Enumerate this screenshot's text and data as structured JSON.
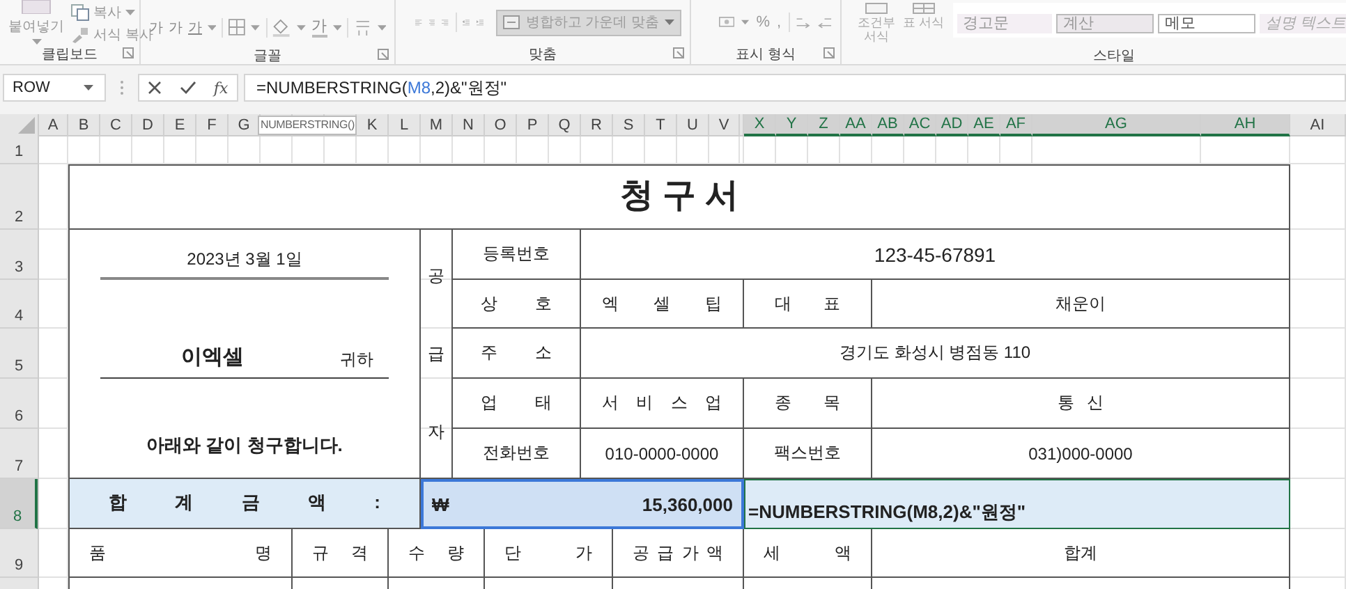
{
  "ribbon": {
    "clipboard": {
      "label": "클립보드",
      "paste": "붙여넣기",
      "copy": "복사",
      "format_painter": "서식 복사"
    },
    "font": {
      "label": "글꼴",
      "buttons": [
        "가",
        "가",
        "가"
      ],
      "font_color": "가"
    },
    "alignment": {
      "label": "맞춤",
      "merge": "병합하고 가운데 맞춤"
    },
    "number": {
      "label": "표시 형식",
      "percent": "%",
      "comma": ","
    },
    "styles": {
      "label": "스타일",
      "conditional": "조건부 서식",
      "table": "표 서식",
      "cells": [
        {
          "label": "경고문",
          "kind": "plain"
        },
        {
          "label": "계산",
          "kind": "calc"
        },
        {
          "label": "메모",
          "kind": "memo"
        },
        {
          "label": "설명 텍스트",
          "kind": "explain"
        }
      ]
    }
  },
  "formula_bar": {
    "name_box": "ROW",
    "function_button": "fx",
    "formula": [
      {
        "text": "=NUMBERSTRING(",
        "kind": "plain"
      },
      {
        "text": "M8",
        "kind": "reference"
      },
      {
        "text": ",2)&\"원정\"",
        "kind": "plain"
      }
    ],
    "tooltip": "NUMBERSTRING()"
  },
  "columns": [
    {
      "label": "A",
      "selected": false
    },
    {
      "label": "B",
      "selected": false
    },
    {
      "label": "C",
      "selected": false
    },
    {
      "label": "D",
      "selected": false
    },
    {
      "label": "E",
      "selected": false
    },
    {
      "label": "F",
      "selected": false
    },
    {
      "label": "G",
      "selected": false
    },
    {
      "label": "K",
      "selected": false
    },
    {
      "label": "L",
      "selected": false
    },
    {
      "label": "M",
      "selected": false
    },
    {
      "label": "N",
      "selected": false
    },
    {
      "label": "O",
      "selected": false
    },
    {
      "label": "P",
      "selected": false
    },
    {
      "label": "Q",
      "selected": false
    },
    {
      "label": "R",
      "selected": false
    },
    {
      "label": "S",
      "selected": false
    },
    {
      "label": "T",
      "selected": false
    },
    {
      "label": "U",
      "selected": false
    },
    {
      "label": "V",
      "selected": false
    },
    {
      "label": "X",
      "selected": true
    },
    {
      "label": "Y",
      "selected": true
    },
    {
      "label": "Z",
      "selected": true
    },
    {
      "label": "AA",
      "selected": true
    },
    {
      "label": "AB",
      "selected": true
    },
    {
      "label": "AC",
      "selected": true
    },
    {
      "label": "AD",
      "selected": true
    },
    {
      "label": "AE",
      "selected": true
    },
    {
      "label": "AF",
      "selected": true
    },
    {
      "label": "AG",
      "selected": true
    },
    {
      "label": "AH",
      "selected": true
    },
    {
      "label": "AI",
      "selected": false
    }
  ],
  "rows": [
    {
      "label": "1",
      "selected": false
    },
    {
      "label": "2",
      "selected": false
    },
    {
      "label": "3",
      "selected": false
    },
    {
      "label": "4",
      "selected": false
    },
    {
      "label": "5",
      "selected": false
    },
    {
      "label": "6",
      "selected": false
    },
    {
      "label": "7",
      "selected": false
    },
    {
      "label": "8",
      "selected": true
    },
    {
      "label": "9",
      "selected": false
    }
  ],
  "invoice": {
    "title": "청 구 서",
    "date": "2023년 3월 1일",
    "recipient": "이엑셀",
    "honorific": "귀하",
    "message": "아래와 같이 청구합니다.",
    "supplier_label": "공급자",
    "registration": {
      "label": "등록번호",
      "value": "123-45-67891"
    },
    "company": {
      "label": "상 호",
      "value": "엑 셀 팁",
      "rep_label": "대 표",
      "rep_value": "채운이"
    },
    "address": {
      "label": "주 소",
      "value": "경기도 화성시 병점동 110"
    },
    "business": {
      "label": "업 태",
      "value": "서 비 스 업",
      "item_label": "종 목",
      "item_value": "통 신"
    },
    "phone": {
      "label": "전화번호",
      "value": "010-0000-0000",
      "fax_label": "팩스번호",
      "fax_value": "031)000-0000"
    },
    "total": {
      "label": "합 계 금 액 :",
      "currency": "₩",
      "amount": "15,360,000",
      "formula": "=NUMBERSTRING(M8,2)&\"원정\""
    },
    "item_headers": [
      "품 명",
      "규 격",
      "수 량",
      "단 가",
      "공 급 가 액",
      "세 액",
      "합계"
    ]
  }
}
